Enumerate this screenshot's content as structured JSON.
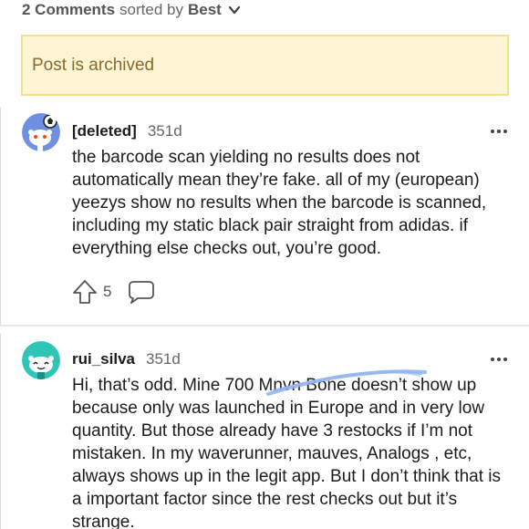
{
  "header": {
    "count_label": "2 Comments",
    "sorted_label": "sorted by",
    "sort_value": "Best"
  },
  "archived_notice": "Post is archived",
  "comments": [
    {
      "username": "[deleted]",
      "age": "351d",
      "body": "the barcode scan yielding no results does not automatically mean they’re fake. all of my (european) yeezys show no results when the barcode is scanned, including my static black pair straight from adidas. if everything else checks out, you’re good.",
      "upvotes": "5"
    },
    {
      "username": "rui_silva",
      "age": "351d",
      "body": "Hi, that’s odd. Mine 700 Mnvn Bone doesn’t show up because only was launched in Europe and in very low quantity. But those already have 3 restocks if I’m not mistaken. In my waverunner, mauves, Analogs , etc, always shows up in the legit app. But I don’t think that is a important factor since the rest checks out but it’s strange."
    }
  ],
  "colors": {
    "archived_bg": "#fdf5d4",
    "archived_border": "#f1e08c",
    "archived_text": "#8a6a2f",
    "deleted_avatar_bg": "#6f8fe0",
    "rui_avatar_bg": "#2ec4b6",
    "scribble": "#8fb0ec"
  },
  "icons": [
    "chevron-down-icon",
    "more-options-icon",
    "upvote-arrow-icon",
    "reply-bubble-icon"
  ]
}
